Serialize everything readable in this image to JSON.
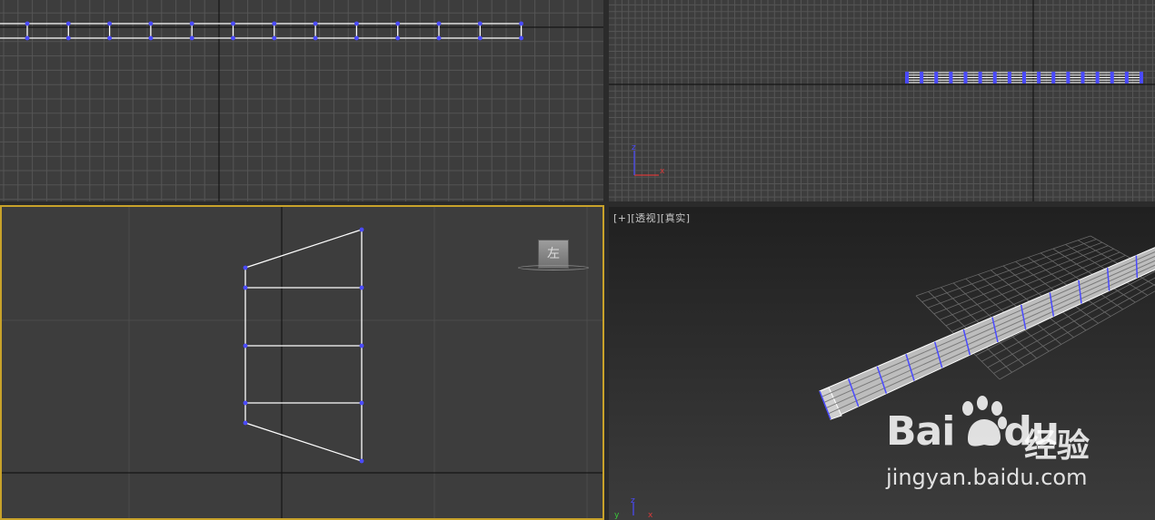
{
  "viewports": {
    "top": {
      "name": "top-viewport"
    },
    "front": {
      "name": "front-viewport"
    },
    "left": {
      "name": "left-viewport"
    },
    "perspective": {
      "name": "perspective-viewport",
      "label_plus": "[+]",
      "label_view": "[透视]",
      "label_shading": "[真实]"
    }
  },
  "viewcube": {
    "face_label": "左"
  },
  "axis_labels": {
    "x": "x",
    "y": "y",
    "z": "z"
  },
  "watermark": {
    "brand": "Bai",
    "brand_tail": "du",
    "product": "经验",
    "url": "jingyan.baidu.com"
  },
  "colors": {
    "viewport_bg": "#3d3d3d",
    "grid_minor": "#555555",
    "grid_major": "#161616",
    "wire": "#ffffff",
    "vertex": "#4a4aff",
    "active_border": "#c8a22a",
    "axis_x": "#d83a3a",
    "axis_y": "#3ac83a",
    "axis_z": "#4a4aff"
  }
}
